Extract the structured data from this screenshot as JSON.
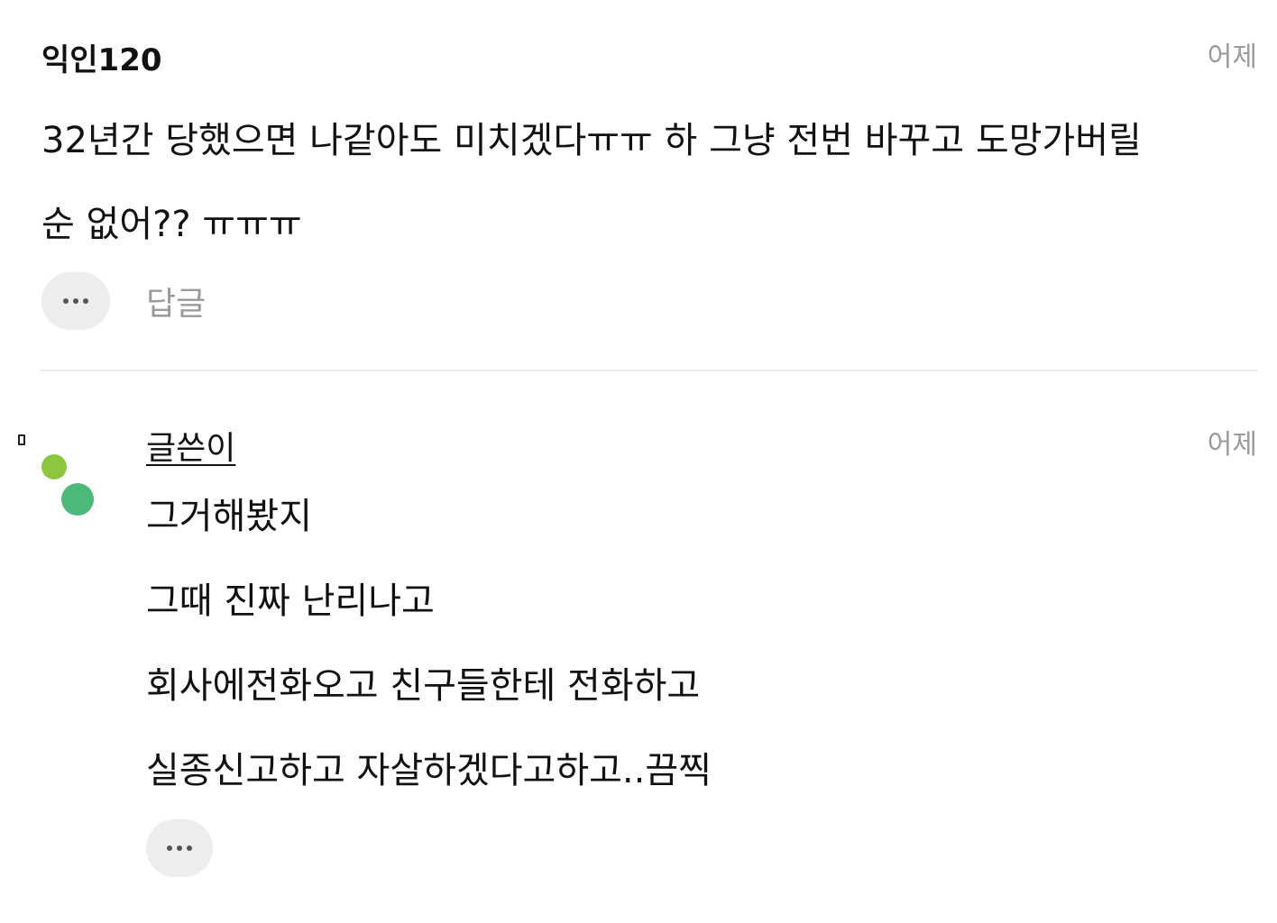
{
  "comment": {
    "author": "익인120",
    "time": "어제",
    "lines": [
      "32년간 당했으면 나같아도 미치겠다ㅠㅠ 하 그냥 전번 바꾸고 도망가버릴",
      "순 없어?? ㅠㅠㅠ"
    ],
    "reply_label": "답글",
    "more_icon": "more-icon"
  },
  "reply": {
    "author": "글쓴이",
    "time": "어제",
    "lines": [
      "그거해봤지",
      "그때 진짜 난리나고",
      "회사에전화오고 친구들한테 전화하고",
      "실종신고하고 자살하겠다고하고..끔찍"
    ],
    "avatar_colors": [
      "#8cc63f",
      "#4cb87a"
    ],
    "more_icon": "more-icon"
  }
}
